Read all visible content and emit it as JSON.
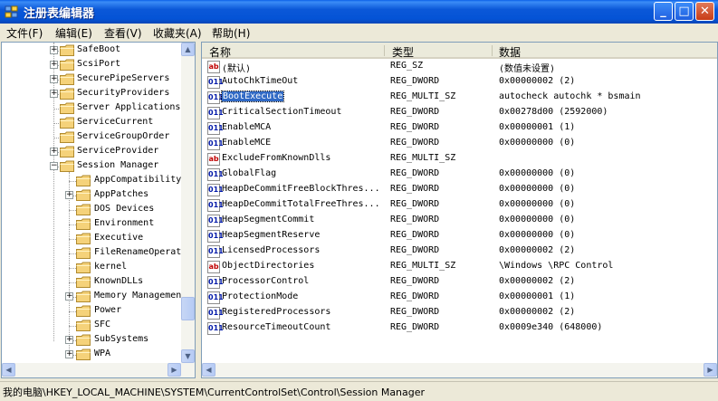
{
  "window": {
    "title": "注册表编辑器",
    "minimize": "_",
    "maximize": "□",
    "close": "✕"
  },
  "menu": [
    "文件(F)",
    "编辑(E)",
    "查看(V)",
    "收藏夹(A)",
    "帮助(H)"
  ],
  "tree": {
    "items": [
      {
        "label": "SafeBoot",
        "expandable": true
      },
      {
        "label": "ScsiPort",
        "expandable": true
      },
      {
        "label": "SecurePipeServers",
        "expandable": true
      },
      {
        "label": "SecurityProviders",
        "expandable": true
      },
      {
        "label": "Server Applications",
        "expandable": false
      },
      {
        "label": "ServiceCurrent",
        "expandable": false
      },
      {
        "label": "ServiceGroupOrder",
        "expandable": false
      },
      {
        "label": "ServiceProvider",
        "expandable": true
      },
      {
        "label": "Session Manager",
        "expandable": true,
        "expanded": true
      },
      {
        "label": "AppCompatibility",
        "expandable": false,
        "child": true
      },
      {
        "label": "AppPatches",
        "expandable": true,
        "child": true
      },
      {
        "label": "DOS Devices",
        "expandable": false,
        "child": true
      },
      {
        "label": "Environment",
        "expandable": false,
        "child": true
      },
      {
        "label": "Executive",
        "expandable": false,
        "child": true
      },
      {
        "label": "FileRenameOperat",
        "expandable": false,
        "child": true
      },
      {
        "label": "kernel",
        "expandable": false,
        "child": true
      },
      {
        "label": "KnownDLLs",
        "expandable": false,
        "child": true
      },
      {
        "label": "Memory Managemen",
        "expandable": true,
        "child": true
      },
      {
        "label": "Power",
        "expandable": false,
        "child": true
      },
      {
        "label": "SFC",
        "expandable": false,
        "child": true
      },
      {
        "label": "SubSystems",
        "expandable": true,
        "child": true
      },
      {
        "label": "WPA",
        "expandable": true,
        "child": true
      }
    ]
  },
  "list": {
    "columns": [
      "名称",
      "类型",
      "数据"
    ],
    "rows": [
      {
        "icon": "ab",
        "name": "(默认)",
        "type": "REG_SZ",
        "data": "(数值未设置)"
      },
      {
        "icon": "bin",
        "name": "AutoChkTimeOut",
        "type": "REG_DWORD",
        "data": "0x00000002 (2)"
      },
      {
        "icon": "bin",
        "name": "BootExecute",
        "type": "REG_MULTI_SZ",
        "data": "autocheck autochk * bsmain",
        "selected": true
      },
      {
        "icon": "bin",
        "name": "CriticalSectionTimeout",
        "type": "REG_DWORD",
        "data": "0x00278d00 (2592000)"
      },
      {
        "icon": "bin",
        "name": "EnableMCA",
        "type": "REG_DWORD",
        "data": "0x00000001 (1)"
      },
      {
        "icon": "bin",
        "name": "EnableMCE",
        "type": "REG_DWORD",
        "data": "0x00000000 (0)"
      },
      {
        "icon": "ab",
        "name": "ExcludeFromKnownDlls",
        "type": "REG_MULTI_SZ",
        "data": ""
      },
      {
        "icon": "bin",
        "name": "GlobalFlag",
        "type": "REG_DWORD",
        "data": "0x00000000 (0)"
      },
      {
        "icon": "bin",
        "name": "HeapDeCommitFreeBlockThres...",
        "type": "REG_DWORD",
        "data": "0x00000000 (0)"
      },
      {
        "icon": "bin",
        "name": "HeapDeCommitTotalFreeThres...",
        "type": "REG_DWORD",
        "data": "0x00000000 (0)"
      },
      {
        "icon": "bin",
        "name": "HeapSegmentCommit",
        "type": "REG_DWORD",
        "data": "0x00000000 (0)"
      },
      {
        "icon": "bin",
        "name": "HeapSegmentReserve",
        "type": "REG_DWORD",
        "data": "0x00000000 (0)"
      },
      {
        "icon": "bin",
        "name": "LicensedProcessors",
        "type": "REG_DWORD",
        "data": "0x00000002 (2)"
      },
      {
        "icon": "ab",
        "name": "ObjectDirectories",
        "type": "REG_MULTI_SZ",
        "data": "\\Windows \\RPC Control"
      },
      {
        "icon": "bin",
        "name": "ProcessorControl",
        "type": "REG_DWORD",
        "data": "0x00000002 (2)"
      },
      {
        "icon": "bin",
        "name": "ProtectionMode",
        "type": "REG_DWORD",
        "data": "0x00000001 (1)"
      },
      {
        "icon": "bin",
        "name": "RegisteredProcessors",
        "type": "REG_DWORD",
        "data": "0x00000002 (2)"
      },
      {
        "icon": "bin",
        "name": "ResourceTimeoutCount",
        "type": "REG_DWORD",
        "data": "0x0009e340 (648000)"
      }
    ]
  },
  "status": "我的电脑\\HKEY_LOCAL_MACHINE\\SYSTEM\\CurrentControlSet\\Control\\Session Manager",
  "colors": {
    "titlebar": "#0453d6",
    "selection": "#316ac5",
    "folder": "#f5d27a"
  }
}
